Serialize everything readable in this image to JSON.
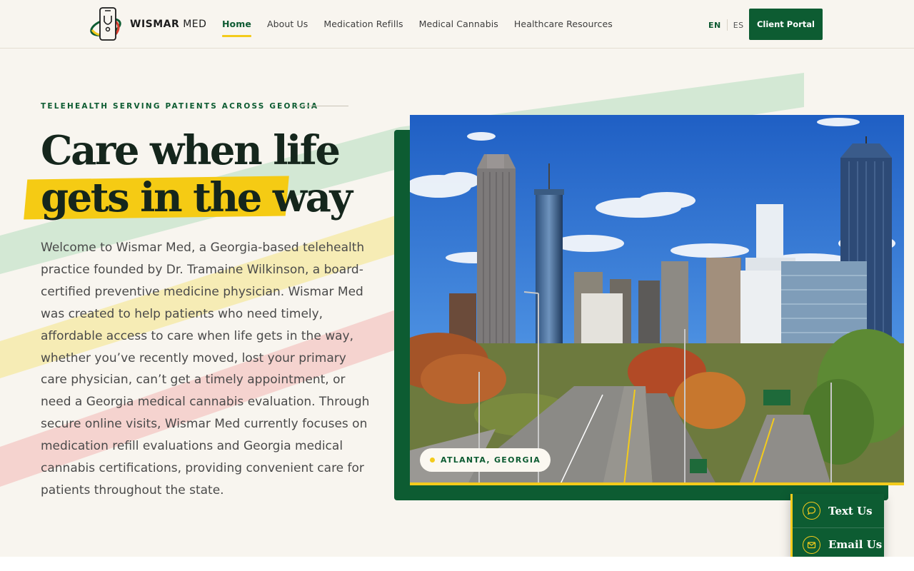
{
  "brand": {
    "name_bold": "WISMAR",
    "name_light": " MED",
    "colors": {
      "green": "#0d5c32",
      "yellow": "#f3cb1c",
      "cream": "#f8f5ef",
      "red_stripe": "#f3c9c6",
      "green_stripe": "#cde5cf"
    }
  },
  "nav": {
    "items": [
      "Home",
      "About Us",
      "Medication Refills",
      "Medical Cannabis",
      "Healthcare Resources"
    ],
    "active": "Home"
  },
  "lang": {
    "en": "EN",
    "es": "ES"
  },
  "header": {
    "portal_label": "Client Portal"
  },
  "hero": {
    "eyebrow": "TELEHEALTH SERVING PATIENTS ACROSS GEORGIA",
    "title_line1": "Care when life",
    "title_line2": "gets in the way",
    "body": "Welcome to Wismar Med, a Georgia-based telehealth practice founded by Dr. Tramaine Wilkinson, a board-certified preventive medicine physician. Wismar Med was created to help patients who need timely, affordable access to care when life gets in the way, whether you’ve recently moved, lost your primary care physician, can’t get a timely appointment, or need a Georgia medical cannabis evaluation. Through secure online visits, Wismar Med currently focuses on medication refill evaluations and Georgia medical cannabis certifications, providing convenient care for patients throughout the state."
  },
  "photo": {
    "location": "ATLANTA, GEORGIA"
  },
  "contact": {
    "text_label": "Text Us",
    "email_label": "Email Us",
    "text_icon": "chat-icon",
    "email_icon": "mail-icon"
  }
}
